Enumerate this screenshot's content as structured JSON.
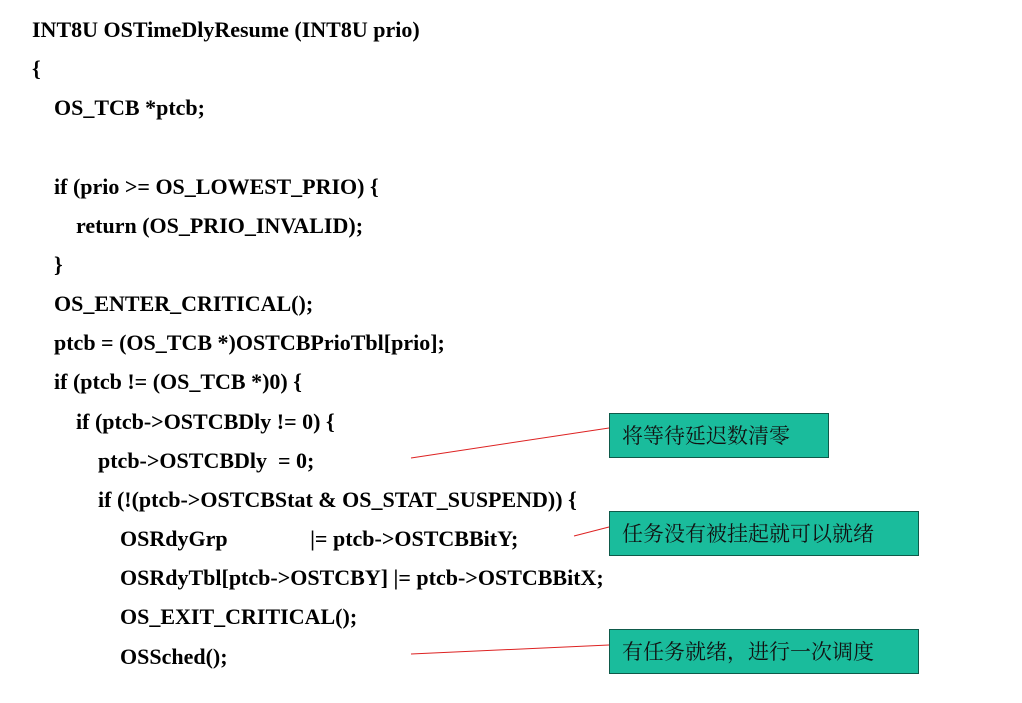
{
  "code": {
    "lines": [
      "INT8U OSTimeDlyResume (INT8U prio)",
      "{",
      "    OS_TCB *ptcb;",
      "",
      "    if (prio >= OS_LOWEST_PRIO) {",
      "        return (OS_PRIO_INVALID);",
      "    }",
      "    OS_ENTER_CRITICAL();",
      "    ptcb = (OS_TCB *)OSTCBPrioTbl[prio];",
      "    if (ptcb != (OS_TCB *)0) {",
      "        if (ptcb->OSTCBDly != 0) {",
      "            ptcb->OSTCBDly  = 0;",
      "            if (!(ptcb->OSTCBStat & OS_STAT_SUSPEND)) {",
      "                OSRdyGrp               |= ptcb->OSTCBBitY;",
      "                OSRdyTbl[ptcb->OSTCBY] |= ptcb->OSTCBBitX;",
      "                OS_EXIT_CRITICAL();",
      "                OSSched();"
    ]
  },
  "callouts": {
    "c1": "将等待延迟数清零",
    "c2": "任务没有被挂起就可以就绪",
    "c3": "有任务就绪，进行一次调度"
  }
}
